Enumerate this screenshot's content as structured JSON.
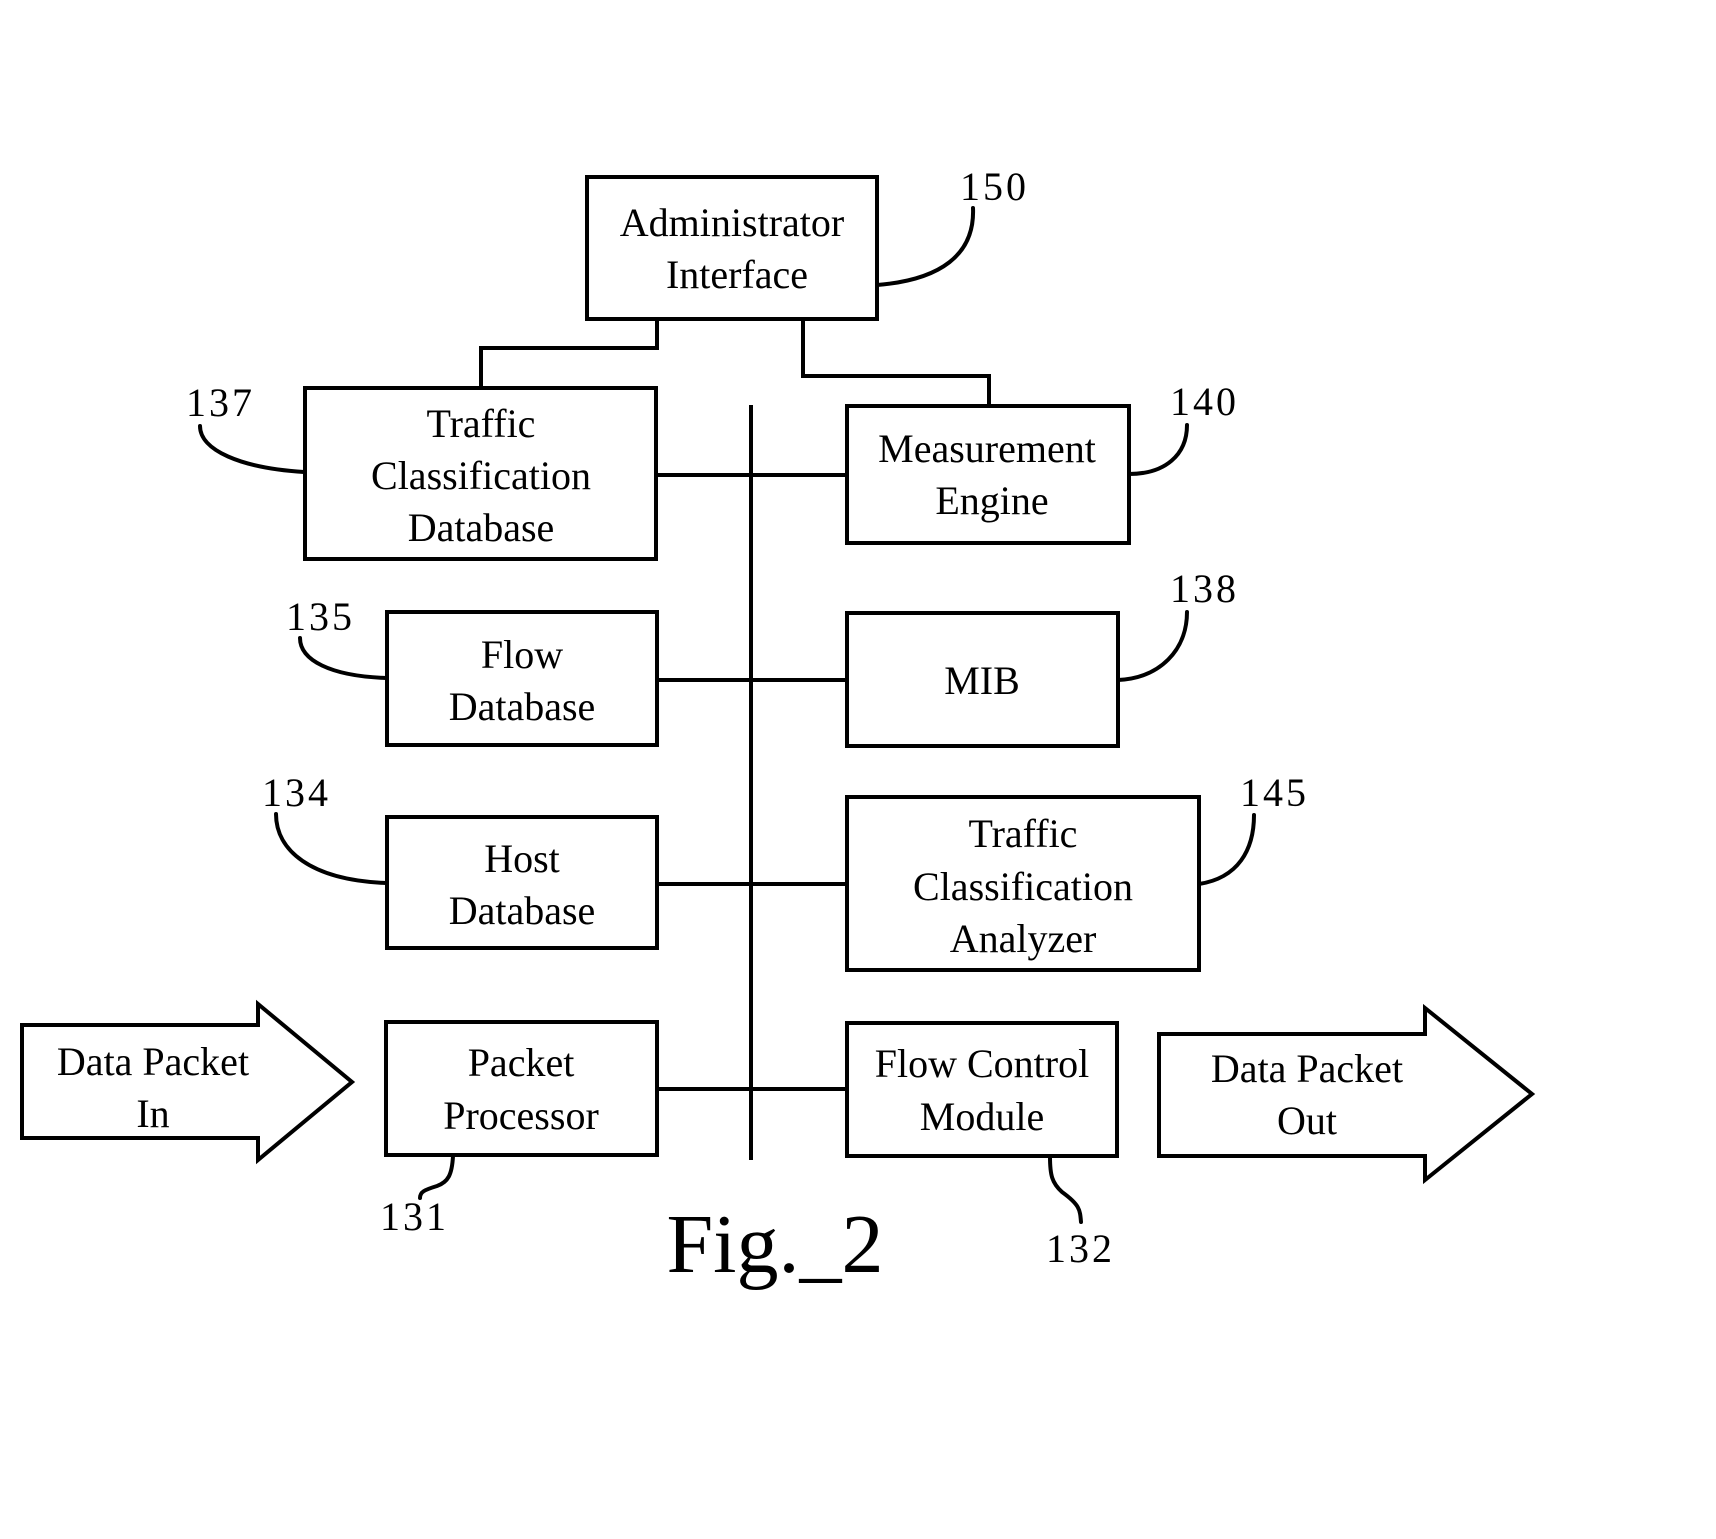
{
  "figure": {
    "caption": "Fig._2",
    "background_color": "#ffffff",
    "ink_color": "#000000"
  },
  "blocks": {
    "admin": {
      "lines": [
        "Administrator",
        "Interface"
      ],
      "ref": "150"
    },
    "tcdb": {
      "lines": [
        "Traffic",
        "Classification",
        "Database"
      ],
      "ref": "137"
    },
    "measure": {
      "lines": [
        "Measurement",
        "Engine"
      ],
      "ref": "140"
    },
    "flowdb": {
      "lines": [
        "Flow",
        "Database"
      ],
      "ref": "135"
    },
    "mib": {
      "lines": [
        "MIB"
      ],
      "ref": "138"
    },
    "hostdb": {
      "lines": [
        "Host",
        "Database"
      ],
      "ref": "134"
    },
    "tca": {
      "lines": [
        "Traffic",
        "Classification",
        "Analyzer"
      ],
      "ref": "145"
    },
    "pp": {
      "lines": [
        "Packet",
        "Processor"
      ],
      "ref": "131"
    },
    "fcm": {
      "lines": [
        "Flow Control",
        "Module"
      ],
      "ref": "132"
    }
  },
  "arrows": {
    "in": {
      "lines": [
        "Data Packet",
        "In"
      ]
    },
    "out": {
      "lines": [
        "Data Packet",
        "Out"
      ]
    }
  }
}
